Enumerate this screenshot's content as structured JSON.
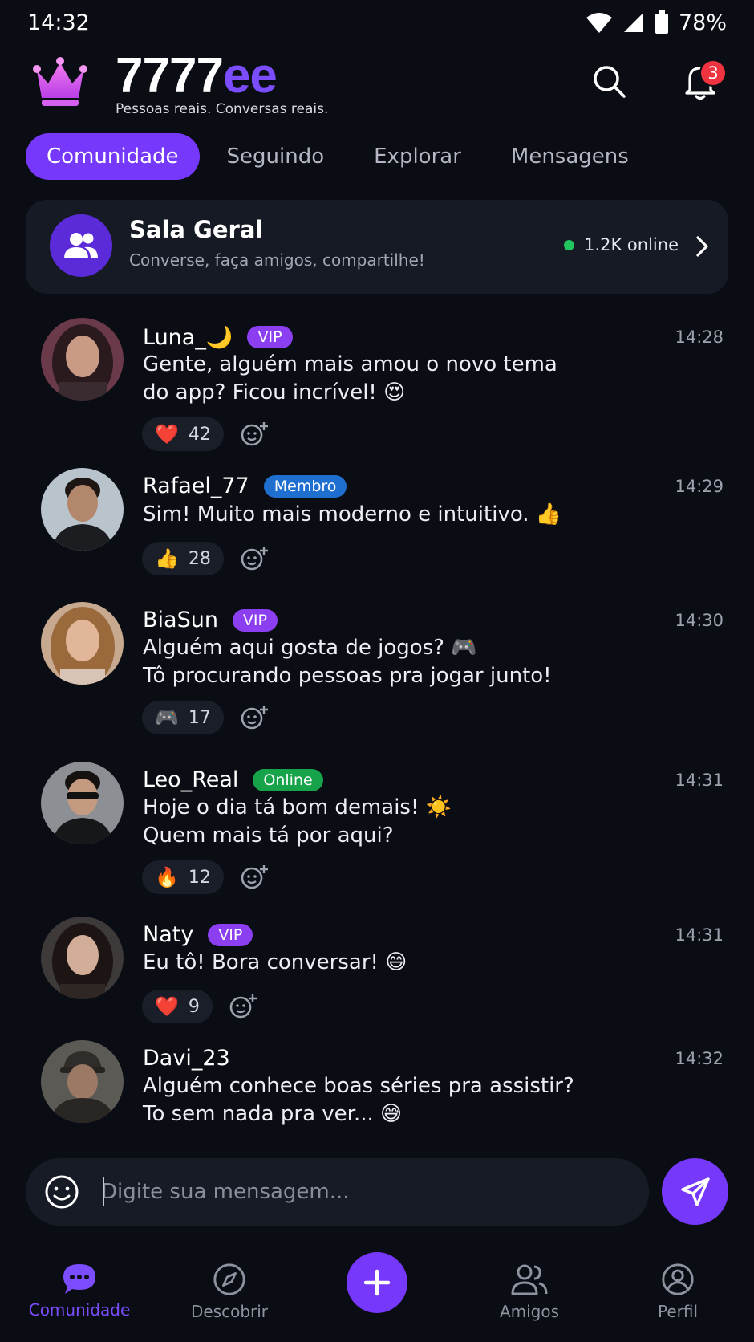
{
  "status": {
    "time": "14:32",
    "battery": "78%"
  },
  "header": {
    "brand_white": "7777",
    "brand_purple": "ee",
    "tagline": "Pessoas reais. Conversas reais.",
    "notif_count": "3"
  },
  "tabs": [
    {
      "label": "Comunidade",
      "active": true
    },
    {
      "label": "Seguindo"
    },
    {
      "label": "Explorar"
    },
    {
      "label": "Mensagens"
    }
  ],
  "room": {
    "title": "Sala Geral",
    "subtitle": "Converse, faça amigos, compartilhe!",
    "online": "1.2K online"
  },
  "messages": [
    {
      "name": "Luna_🌙",
      "badge": "VIP",
      "time": "14:28",
      "line1": "Gente, alguém mais amou o novo tema",
      "line2": "do app? Ficou incrível! 😍",
      "reaction_emoji": "❤️",
      "reaction_count": "42"
    },
    {
      "name": "Rafael_77",
      "badge": "Membro",
      "time": "14:29",
      "line1": "Sim! Muito mais moderno e intuitivo. 👍",
      "reaction_emoji": "👍",
      "reaction_count": "28"
    },
    {
      "name": "BiaSun",
      "badge": "VIP",
      "time": "14:30",
      "line1": "Alguém aqui gosta de jogos? 🎮",
      "line2": "Tô procurando pessoas pra jogar junto!",
      "reaction_emoji": "🎮",
      "reaction_count": "17"
    },
    {
      "name": "Leo_Real",
      "badge": "Online",
      "time": "14:31",
      "line1": "Hoje o dia tá bom demais! ☀️",
      "line2": "Quem mais tá por aqui?",
      "reaction_emoji": "🔥",
      "reaction_count": "12"
    },
    {
      "name": "Naty",
      "badge": "VIP",
      "time": "14:31",
      "line1": "Eu tô! Bora conversar! 😄",
      "reaction_emoji": "❤️",
      "reaction_count": "9"
    },
    {
      "name": "Davi_23",
      "time": "14:32",
      "line1": "Alguém conhece boas séries pra assistir?",
      "line2": "To sem nada pra ver... 😅"
    }
  ],
  "composer": {
    "placeholder": "Digite sua mensagem..."
  },
  "nav": [
    {
      "label": "Comunidade",
      "active": true
    },
    {
      "label": "Descobrir"
    },
    {
      "label": "Amigos"
    },
    {
      "label": "Perfil"
    }
  ],
  "colors": {
    "accent": "#7638fa",
    "vip": "#8b3ff0",
    "member": "#1f6fd1",
    "online": "#16a34a",
    "badge_red": "#ef3340"
  }
}
